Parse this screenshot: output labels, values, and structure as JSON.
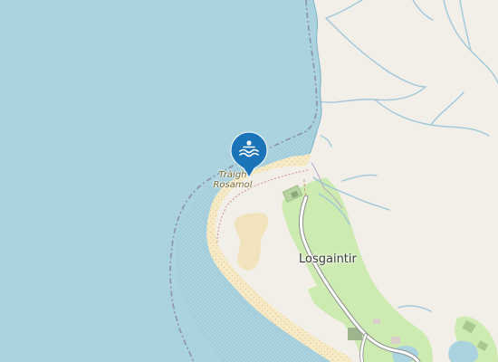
{
  "map": {
    "beach_label_line1": "Tràigh",
    "beach_label_line2": "Rosamol",
    "place_label": "Losgaintir",
    "marker_icon": "swimming-icon",
    "colors": {
      "sea": "#aad3df",
      "land": "#f2efe9",
      "sand": "#f5e9c6",
      "grass": "#cdebb0",
      "stream": "#9fc8d8",
      "marker": "#1b74b8",
      "boundary": "#8e8fa8"
    }
  }
}
